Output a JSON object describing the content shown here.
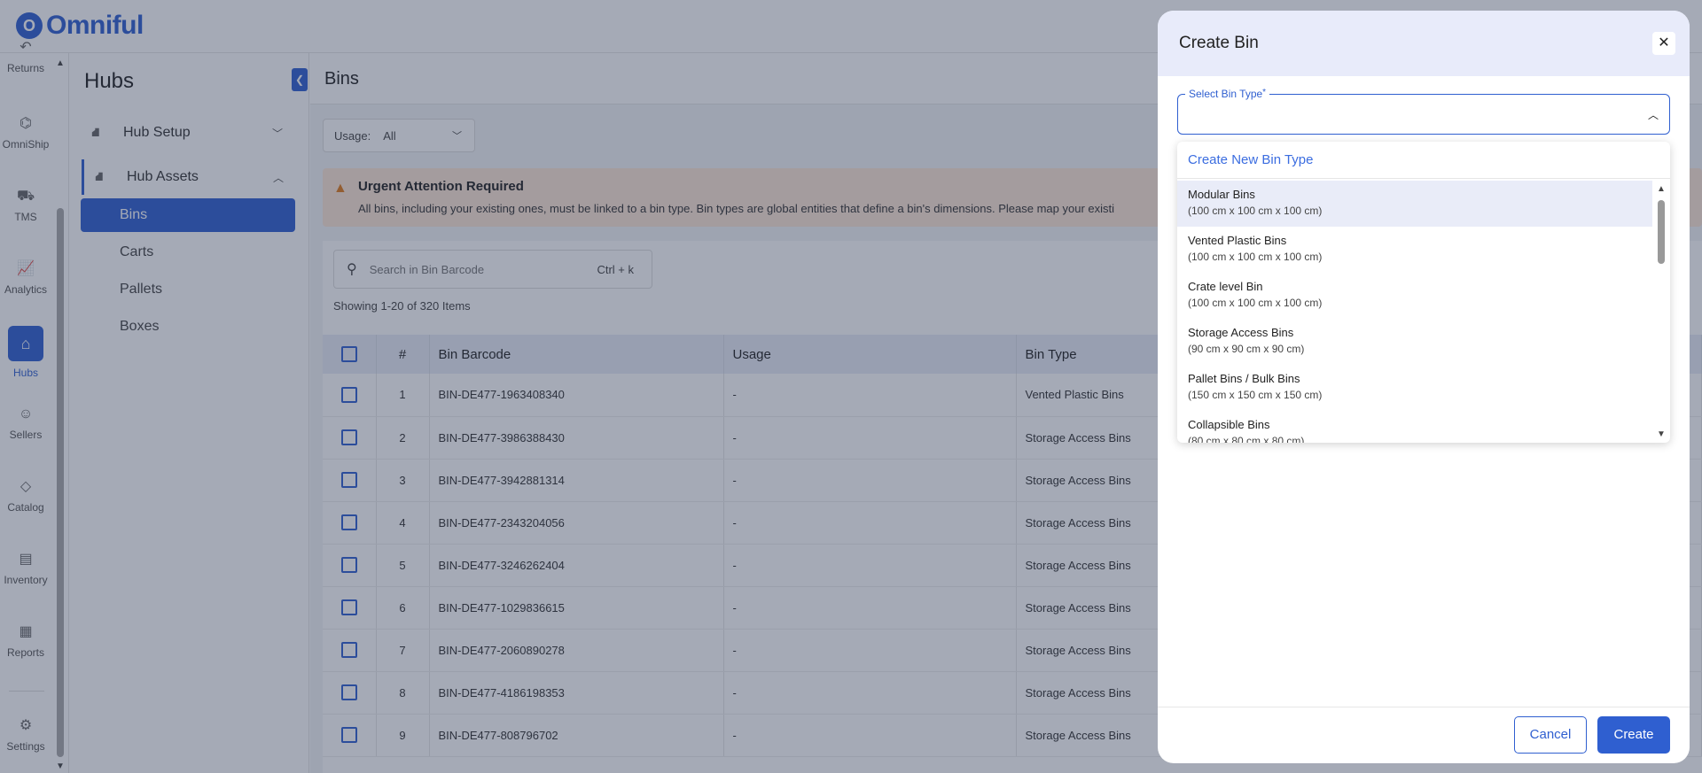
{
  "brand": {
    "name": "Omniful",
    "mark": "O"
  },
  "rail": {
    "items": [
      {
        "label": "Returns",
        "icon": "returns-icon",
        "glyph": "↶"
      },
      {
        "label": "OmniShip",
        "icon": "omniship-icon",
        "glyph": "⌬"
      },
      {
        "label": "TMS",
        "icon": "truck-icon",
        "glyph": "⛟"
      },
      {
        "label": "Analytics",
        "icon": "analytics-icon",
        "glyph": "📈"
      },
      {
        "label": "Hubs",
        "icon": "warehouse-icon",
        "glyph": "⌂"
      },
      {
        "label": "Sellers",
        "icon": "user-icon",
        "glyph": "☺"
      },
      {
        "label": "Catalog",
        "icon": "catalog-icon",
        "glyph": "◇"
      },
      {
        "label": "Inventory",
        "icon": "inventory-icon",
        "glyph": "▤"
      },
      {
        "label": "Reports",
        "icon": "reports-icon",
        "glyph": "▦"
      },
      {
        "label": "Settings",
        "icon": "gear-icon",
        "glyph": "⚙"
      }
    ]
  },
  "sidebar": {
    "title": "Hubs",
    "groups": [
      {
        "label": "Hub Setup"
      },
      {
        "label": "Hub Assets"
      }
    ],
    "sub_items": [
      {
        "label": "Bins"
      },
      {
        "label": "Carts"
      },
      {
        "label": "Pallets"
      },
      {
        "label": "Boxes"
      }
    ]
  },
  "main": {
    "title": "Bins",
    "filter": {
      "label": "Usage:",
      "value": "All"
    },
    "alert": {
      "title": "Urgent Attention Required",
      "text": "All bins, including your existing ones, must be linked to a bin type. Bin types are global entities that define a bin's dimensions. Please map your existi"
    },
    "search": {
      "placeholder": "Search in Bin Barcode",
      "shortcut": "Ctrl + k"
    },
    "showing": "Showing 1-20 of 320 Items",
    "columns": [
      "#",
      "Bin Barcode",
      "Usage",
      "Bin Type"
    ],
    "rows": [
      {
        "num": "1",
        "barcode": "BIN-DE477-1963408340",
        "usage": "-",
        "type": "Vented Plastic Bins"
      },
      {
        "num": "2",
        "barcode": "BIN-DE477-3986388430",
        "usage": "-",
        "type": "Storage Access Bins"
      },
      {
        "num": "3",
        "barcode": "BIN-DE477-3942881314",
        "usage": "-",
        "type": "Storage Access Bins"
      },
      {
        "num": "4",
        "barcode": "BIN-DE477-2343204056",
        "usage": "-",
        "type": "Storage Access Bins"
      },
      {
        "num": "5",
        "barcode": "BIN-DE477-3246262404",
        "usage": "-",
        "type": "Storage Access Bins"
      },
      {
        "num": "6",
        "barcode": "BIN-DE477-1029836615",
        "usage": "-",
        "type": "Storage Access Bins"
      },
      {
        "num": "7",
        "barcode": "BIN-DE477-2060890278",
        "usage": "-",
        "type": "Storage Access Bins"
      },
      {
        "num": "8",
        "barcode": "BIN-DE477-4186198353",
        "usage": "-",
        "type": "Storage Access Bins"
      },
      {
        "num": "9",
        "barcode": "BIN-DE477-808796702",
        "usage": "-",
        "type": "Storage Access Bins"
      }
    ]
  },
  "drawer": {
    "title": "Create Bin",
    "select_label": "Select Bin Type",
    "required_mark": "*",
    "create_new": "Create New Bin Type",
    "options": [
      {
        "name": "Modular Bins",
        "dims": "(100 cm x 100 cm x 100 cm)"
      },
      {
        "name": "Vented Plastic Bins",
        "dims": "(100 cm x 100 cm x 100 cm)"
      },
      {
        "name": "Crate level Bin",
        "dims": "(100 cm x 100 cm x 100 cm)"
      },
      {
        "name": "Storage Access Bins",
        "dims": "(90 cm x 90 cm x 90 cm)"
      },
      {
        "name": "Pallet Bins / Bulk Bins",
        "dims": "(150 cm x 150 cm x 150 cm)"
      },
      {
        "name": "Collapsible Bins",
        "dims": "(80 cm x 80 cm x 80 cm)"
      }
    ],
    "cancel_label": "Cancel",
    "create_label": "Create"
  },
  "colors": {
    "accent": "#2f5fd0",
    "alert_bg": "#fde7d6",
    "overlay": "rgba(40,52,80,0.42)"
  }
}
